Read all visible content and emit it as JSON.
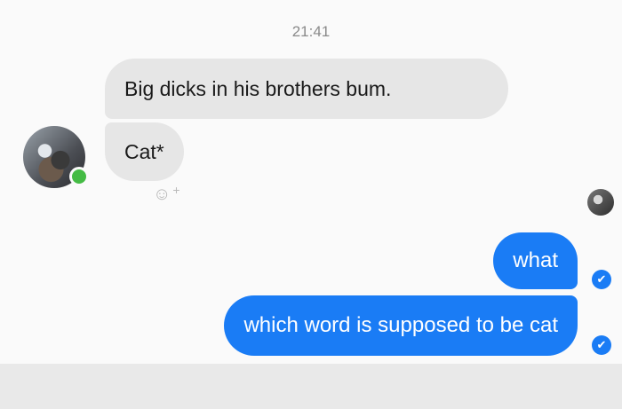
{
  "conversation": {
    "timestamp": "21:41",
    "incoming": [
      {
        "text": "Big dicks in his brothers bum."
      },
      {
        "text": "Cat*"
      }
    ],
    "outgoing": [
      {
        "text": "what"
      },
      {
        "text": "which word is supposed to be cat"
      }
    ]
  },
  "icons": {
    "reaction": "smiley-reaction-icon",
    "delivered": "check-circle-icon"
  },
  "colors": {
    "outgoing_bubble": "#1a7cf5",
    "incoming_bubble": "#e6e6e6",
    "online_status": "#44bb44"
  }
}
